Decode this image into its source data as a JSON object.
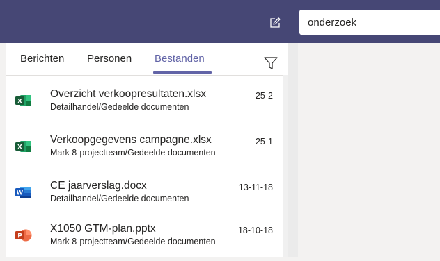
{
  "search": {
    "value": "onderzoek"
  },
  "tabs": [
    {
      "label": "Berichten"
    },
    {
      "label": "Personen"
    },
    {
      "label": "Bestanden"
    }
  ],
  "icons": {
    "compose": "compose-icon",
    "filter": "filter-icon",
    "excel": "excel-file-icon",
    "word": "word-file-icon",
    "powerpoint": "powerpoint-file-icon"
  },
  "colors": {
    "topbar": "#464775",
    "accent": "#6264a7",
    "excel": "#1e7145",
    "word": "#2b579a",
    "powerpoint": "#d24726"
  },
  "files": [
    {
      "name": "Overzicht verkoopresultaten.xlsx",
      "path": "Detailhandel/Gedeelde documenten",
      "date": "25-2",
      "type": "excel"
    },
    {
      "name": "Verkoopgegevens campagne.xlsx",
      "path": "Mark 8-projectteam/Gedeelde documenten",
      "date": "25-1",
      "type": "excel"
    },
    {
      "name": "CE jaarverslag.docx",
      "path": "Detailhandel/Gedeelde documenten",
      "date": "13-11-18",
      "type": "word"
    },
    {
      "name": "X1050 GTM-plan.pptx",
      "path": "Mark 8-projectteam/Gedeelde documenten",
      "date": "18-10-18",
      "type": "powerpoint"
    }
  ]
}
